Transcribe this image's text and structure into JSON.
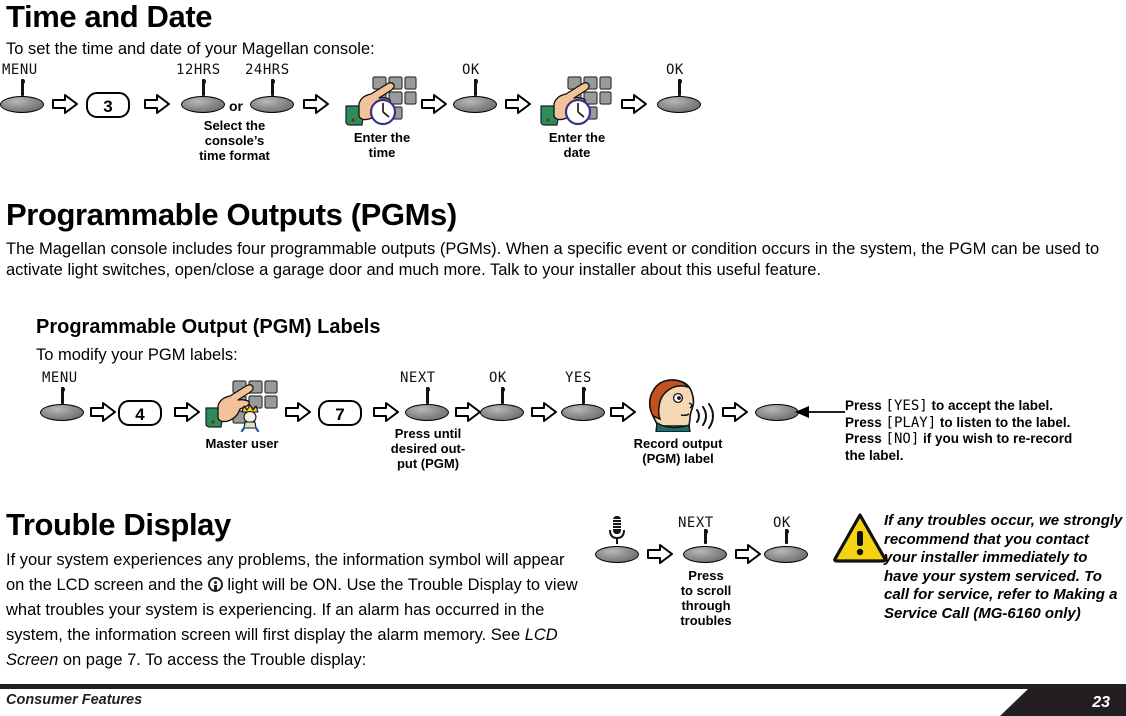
{
  "sections": {
    "time_and_date": {
      "title": "Time and Date",
      "intro": "To set the time and date of your Magellan console:",
      "steps": {
        "menu_label": "MENU",
        "key3": "3",
        "hr12_label": "12HRS",
        "hr24_label": "24HRS",
        "or": "or",
        "format_caption": "Select the\nconsole’s\ntime format",
        "enter_time_caption": "Enter the\ntime",
        "ok_label_1": "OK",
        "enter_date_caption": "Enter the\ndate",
        "ok_label_2": "OK"
      }
    },
    "pgm": {
      "title": "Programmable Outputs (PGMs)",
      "paragraph": "The Magellan console includes four programmable outputs (PGMs). When a specific event or condition occurs in the system, the PGM can be used to activate light switches, open/close a garage door and much more. Talk to your installer about this useful feature.",
      "sub_title": "Programmable Output (PGM) Labels",
      "sub_intro": "To modify your PGM labels:",
      "steps": {
        "menu_label": "MENU",
        "key4": "4",
        "master_user_caption": "Master user",
        "key7": "7",
        "next_label": "NEXT",
        "next_caption": "Press until\ndesired out-\nput (PGM)",
        "ok_label": "OK",
        "yes_label": "YES",
        "record_caption": "Record output\n(PGM) label"
      },
      "note": {
        "line1_pre": "Press ",
        "line1_key": "[YES]",
        "line1_post": " to accept the label.",
        "line2_pre": "Press ",
        "line2_key": "[PLAY]",
        "line2_post": " to listen to the label.",
        "line3_pre": "Press ",
        "line3_key": "[NO]",
        "line3_post": " if you wish to re-record",
        "line4": "the label."
      }
    },
    "trouble": {
      "title": "Trouble Display",
      "para_part1": "If your system experiences any problems, the information symbol will appear on the LCD screen and the ",
      "para_part2": " light will be ON. Use the Trouble Display to view what troubles your system is experiencing. If an alarm has occurred in the system, the information screen will first display the alarm memory. See ",
      "para_italic": "LCD Screen",
      "para_part3": " on page 7. To access the Trouble display:",
      "steps": {
        "next_label": "NEXT",
        "scroll_caption": "Press\nto scroll\nthrough\ntroubles",
        "ok_label": "OK"
      },
      "warning": "If any troubles occur, we strongly recommend that you contact your installer immediately to have your system serviced. To call for service, refer to Making a Service Call (MG-6160 only)"
    }
  },
  "footer": {
    "left": "Consumer Features",
    "page_number": "23"
  },
  "icons": {
    "button": "oval-push-button",
    "arrow": "block-arrow-right",
    "hand_keypad_clock": "hand-pressing-keypad-with-clock-icon",
    "hand_keypad_king": "hand-pressing-keypad-with-master-user-icon",
    "talking_head": "talking-head-icon",
    "microphone": "microphone-icon",
    "warning_triangle": "warning-triangle-icon",
    "info": "information-icon"
  },
  "colors": {
    "warning_yellow": "#F5D313",
    "skin": "#F2C398",
    "sleeve_green": "#2E8B57",
    "key_gray": "#8A8A8A",
    "footer_black": "#231F20",
    "clock_purple": "#3B2F8F",
    "hair_orange": "#C4521E"
  }
}
